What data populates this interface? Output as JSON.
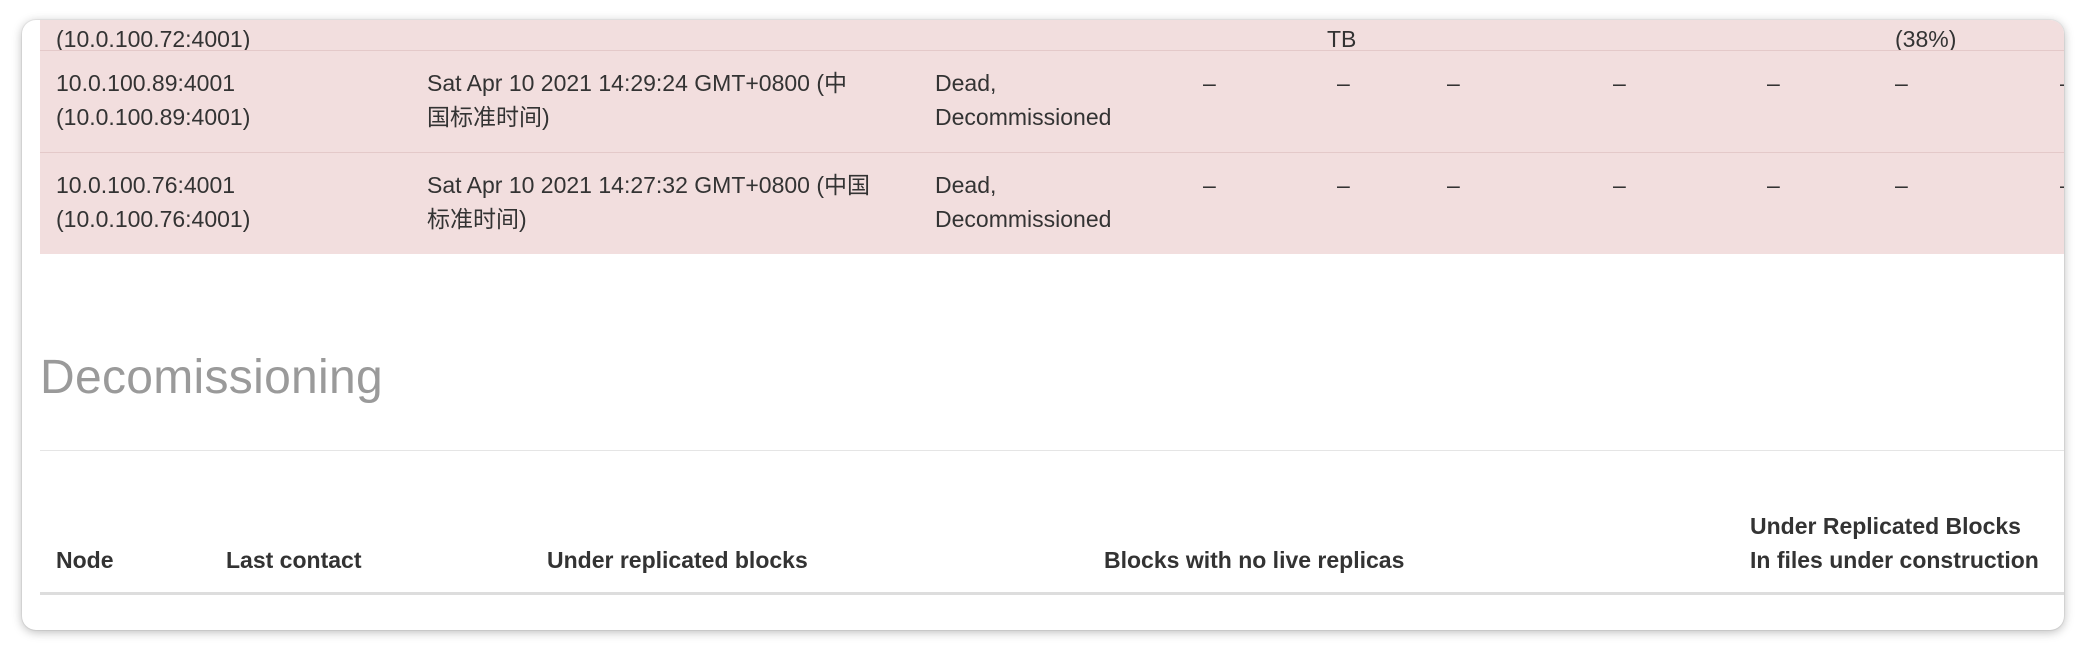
{
  "partial_row": {
    "node": "(10.0.100.72:4001)",
    "col_a": "TB",
    "col_b": "(38%)"
  },
  "rows": [
    {
      "node_line1": "10.0.100.89:4001",
      "node_line2": "(10.0.100.89:4001)",
      "contact_line1": "Sat Apr 10 2021 14:29:24 GMT+0800 (中",
      "contact_line2": "国标准时间)",
      "state_line1": "Dead,",
      "state_line2": "Decommissioned",
      "dashes": [
        "–",
        "–",
        "–",
        "–",
        "–",
        "–",
        "–"
      ]
    },
    {
      "node_line1": "10.0.100.76:4001",
      "node_line2": "(10.0.100.76:4001)",
      "contact_line1": "Sat Apr 10 2021 14:27:32 GMT+0800 (中国",
      "contact_line2": "标准时间)",
      "state_line1": "Dead,",
      "state_line2": "Decommissioned",
      "dashes": [
        "–",
        "–",
        "–",
        "–",
        "–",
        "–",
        "–"
      ]
    }
  ],
  "decommissioning": {
    "title": "Decomissioning",
    "headers": {
      "node": "Node",
      "last_contact": "Last contact",
      "under_replicated": "Under replicated blocks",
      "no_live_replicas": "Blocks with no live replicas",
      "under_construction_line1": "Under Replicated Blocks",
      "under_construction_line2": "In files under construction"
    }
  },
  "colors": {
    "dead_row_bg": "#f2dede",
    "section_title": "#9a9a9a",
    "text": "#333333"
  }
}
